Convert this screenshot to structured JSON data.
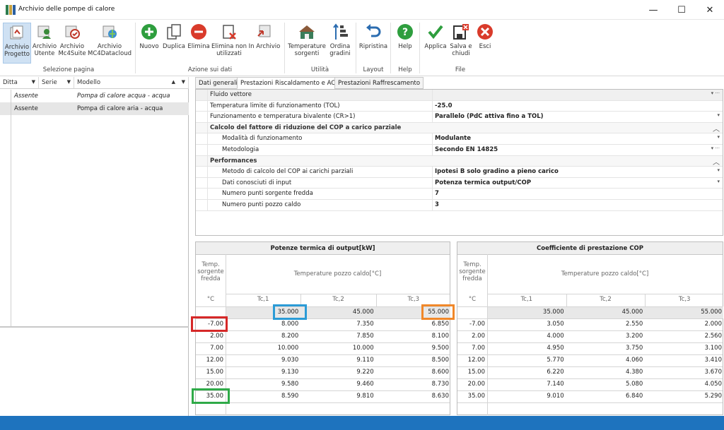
{
  "window": {
    "title": "Archivio delle pompe di calore",
    "minimize_icon": "—",
    "maximize_icon": "☐",
    "close_icon": "✕"
  },
  "ribbon": {
    "buttons": [
      {
        "id": "archivio-progetto",
        "label1": "Archivio",
        "label2": "Progetto",
        "icon": "project-archive-icon"
      },
      {
        "id": "archivio-utente",
        "label1": "Archivio",
        "label2": "Utente",
        "icon": "user-archive-icon"
      },
      {
        "id": "archivio-mc4suite",
        "label1": "Archivio",
        "label2": "Mc4Suite",
        "icon": "mc4suite-archive-icon"
      },
      {
        "id": "archivio-mc4datacloud",
        "label1": "Archivio",
        "label2": "MC4Datacloud",
        "icon": "datacloud-archive-icon"
      },
      {
        "id": "nuovo",
        "label1": "Nuovo",
        "label2": "",
        "icon": "plus-icon"
      },
      {
        "id": "duplica",
        "label1": "Duplica",
        "label2": "",
        "icon": "copy-icon"
      },
      {
        "id": "elimina",
        "label1": "Elimina",
        "label2": "",
        "icon": "delete-icon"
      },
      {
        "id": "elimina-non-utilizzati",
        "label1": "Elimina non",
        "label2": "utilizzati",
        "icon": "delete-unused-icon"
      },
      {
        "id": "in-archivio",
        "label1": "In Archivio",
        "label2": "",
        "icon": "to-archive-icon"
      },
      {
        "id": "temperature-sorgenti",
        "label1": "Temperature",
        "label2": "sorgenti",
        "icon": "house-temperature-icon"
      },
      {
        "id": "ordina-gradini",
        "label1": "Ordina",
        "label2": "gradini",
        "icon": "sort-steps-icon"
      },
      {
        "id": "ripristina",
        "label1": "Ripristina",
        "label2": "",
        "icon": "undo-icon"
      },
      {
        "id": "help",
        "label1": "Help",
        "label2": "",
        "icon": "help-icon"
      },
      {
        "id": "applica",
        "label1": "Applica",
        "label2": "",
        "icon": "checkmark-icon"
      },
      {
        "id": "salva-chiudi",
        "label1": "Salva e",
        "label2": "chiudi",
        "icon": "save-close-icon"
      },
      {
        "id": "esci",
        "label1": "Esci",
        "label2": "",
        "icon": "exit-icon"
      }
    ],
    "groups": [
      "Selezione pagina",
      "Azione sui dati",
      "Utilità",
      "Layout",
      "Help",
      "File"
    ]
  },
  "left_grid": {
    "columns": [
      "Ditta",
      "Serie",
      "Modello"
    ],
    "rows": [
      {
        "ditta": "Assente",
        "serie": "",
        "modello": "Pompa di calore acqua - acqua"
      },
      {
        "ditta": "Assente",
        "serie": "",
        "modello": "Pompa di calore aria - acqua"
      }
    ]
  },
  "tabs": [
    "Dati generali",
    "Prestazioni Riscaldamento e ACS",
    "Prestazioni Raffrescamento"
  ],
  "properties": [
    {
      "label": "Fluido vettore",
      "value": ""
    },
    {
      "label": "Temperatura limite di funzionamento (TOL)",
      "value": "-25.0"
    },
    {
      "label": "Funzionamento e temperatura bivalente (CR>1)",
      "value": "Parallelo (PdC attiva fino a TOL)"
    },
    {
      "label": "Calcolo del fattore di riduzione del COP a carico parziale",
      "value": ""
    },
    {
      "label": "Modalità di funzionamento",
      "value": "Modulante"
    },
    {
      "label": "Metodologia",
      "value": "Secondo EN 14825"
    },
    {
      "label": "Performances",
      "value": ""
    },
    {
      "label": "Metodo di calcolo del COP ai carichi parziali",
      "value": "Ipotesi B solo gradino a pieno carico"
    },
    {
      "label": "Dati conosciuti di input",
      "value": "Potenza termica output/COP"
    },
    {
      "label": "Numero punti sorgente fredda",
      "value": "7"
    },
    {
      "label": "Numero punti pozzo caldo",
      "value": "3"
    }
  ],
  "table_power": {
    "title": "Potenze termica di output[kW]",
    "source_header": "Temp. sorgente fredda",
    "sink_header": "Temperature pozzo caldo[°C]",
    "unit": "°C",
    "cols": [
      "Tc,1",
      "Tc,2",
      "Tc,3"
    ],
    "sink_temps": [
      "35.000",
      "45.000",
      "55.000"
    ],
    "source_temps": [
      "-7.00",
      "2.00",
      "7.00",
      "12.00",
      "15.00",
      "20.00",
      "35.00"
    ],
    "values": [
      [
        "8.000",
        "7.350",
        "6.850"
      ],
      [
        "8.200",
        "7.850",
        "8.100"
      ],
      [
        "10.000",
        "10.000",
        "9.500"
      ],
      [
        "9.030",
        "9.110",
        "8.500"
      ],
      [
        "9.130",
        "9.220",
        "8.600"
      ],
      [
        "9.580",
        "9.460",
        "8.730"
      ],
      [
        "8.590",
        "9.810",
        "8.630"
      ]
    ]
  },
  "table_cop": {
    "title": "Coefficiente di prestazione COP",
    "source_header": "Temp. sorgente fredda",
    "sink_header": "Temperature pozzo caldo[°C]",
    "unit": "°C",
    "cols": [
      "Tc,1",
      "Tc,2",
      "Tc,3"
    ],
    "sink_temps": [
      "35.000",
      "45.000",
      "55.000"
    ],
    "source_temps": [
      "-7.00",
      "2.00",
      "7.00",
      "12.00",
      "15.00",
      "20.00",
      "35.00"
    ],
    "values": [
      [
        "3.050",
        "2.550",
        "2.000"
      ],
      [
        "4.000",
        "3.200",
        "2.560"
      ],
      [
        "4.950",
        "3.750",
        "3.100"
      ],
      [
        "5.770",
        "4.060",
        "3.410"
      ],
      [
        "6.220",
        "4.380",
        "3.670"
      ],
      [
        "7.140",
        "5.080",
        "4.050"
      ],
      [
        "9.010",
        "6.840",
        "5.290"
      ]
    ]
  },
  "highlight_colors": {
    "red": "#d62828",
    "blue": "#2b9bd6",
    "orange": "#f0882a",
    "green": "#2faa48"
  },
  "statusbar_color": "#1e73be"
}
